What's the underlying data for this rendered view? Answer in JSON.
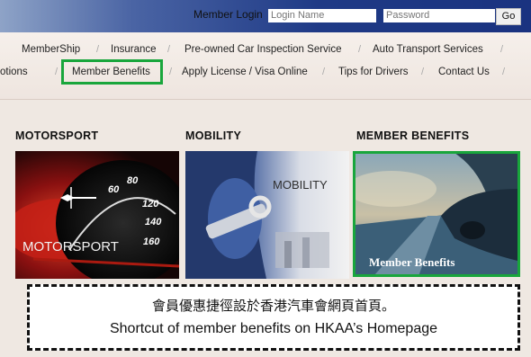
{
  "login_bar": {
    "label": "Member Login",
    "username_placeholder": "Login Name",
    "password_placeholder": "Password",
    "go_label": "Go"
  },
  "nav": {
    "row1": [
      "MemberShip",
      "Insurance",
      "Pre-owned Car Inspection Service",
      "Auto Transport Services"
    ],
    "row2": [
      "otions",
      "Member Benefits",
      "Apply License / Visa Online",
      "Tips for Drivers",
      "Contact Us"
    ],
    "separator": "/"
  },
  "categories": [
    {
      "title": "MOTORSPORT",
      "image_text": "MOTORSPORT"
    },
    {
      "title": "MOBILITY",
      "image_text": "MOBILITY"
    },
    {
      "title": "MEMBER BENEFITS",
      "image_text": "Member Benefits"
    }
  ],
  "speedometer_labels": [
    "60",
    "80",
    "120",
    "140",
    "160"
  ],
  "caption": {
    "zh": "會員優惠捷徑設於香港汽車會網頁首頁。",
    "en": "Shortcut of member benefits on HKAA’s Homepage"
  },
  "colors": {
    "highlight": "#19a63c",
    "login_bar": "#1f3a86",
    "nav_background": "#f3ece7"
  }
}
